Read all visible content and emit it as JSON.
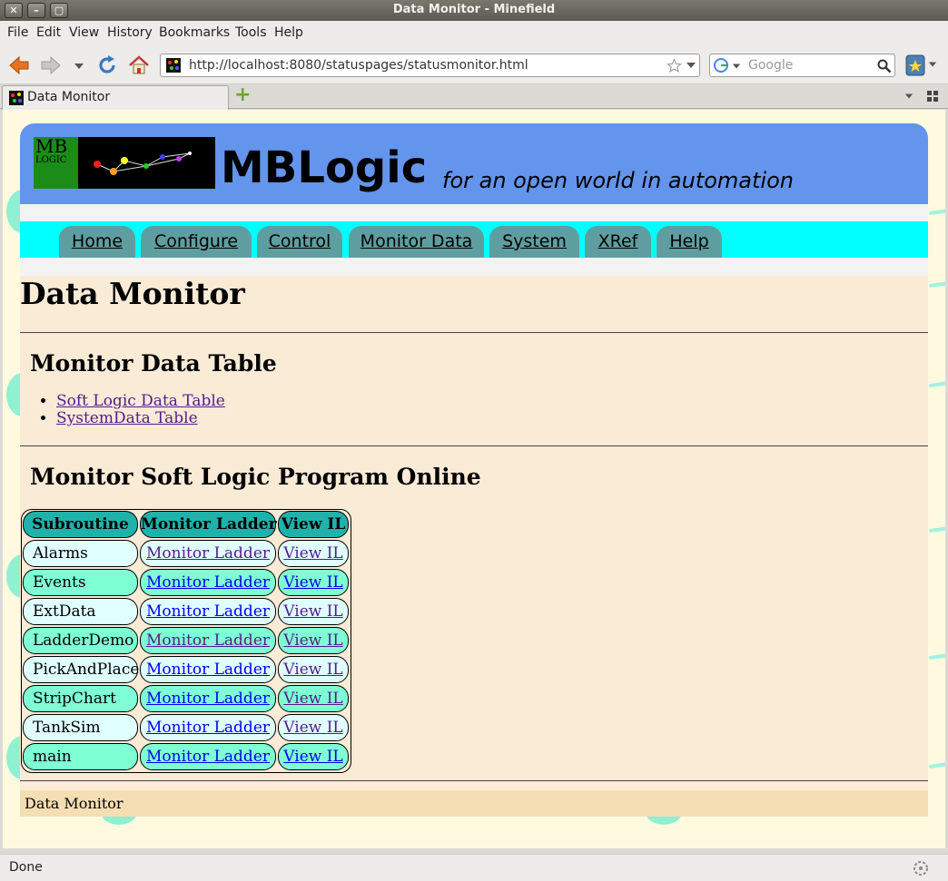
{
  "window": {
    "title": "Data Monitor - Minefield",
    "close_glyph": "✕",
    "minimize_glyph": "–",
    "maximize_glyph": "▢"
  },
  "menubar": {
    "items": [
      "File",
      "Edit",
      "View",
      "History",
      "Bookmarks",
      "Tools",
      "Help"
    ]
  },
  "navbar": {
    "url": "http://localhost:8080/statuspages/statusmonitor.html",
    "search_placeholder": "Google"
  },
  "tab": {
    "label": "Data Monitor",
    "new_tab_glyph": "+"
  },
  "banner": {
    "logo_mb": "MB",
    "logo_logic": "LOGIC",
    "brand": "MBLogic",
    "tagline": "for an open world in automation"
  },
  "menu": {
    "items": [
      "Home",
      "Configure",
      "Control",
      "Monitor Data",
      "System",
      "XRef",
      "Help"
    ]
  },
  "content": {
    "page_title": "Data Monitor",
    "section1_title": "Monitor Data Table",
    "links": [
      "Soft Logic Data Table",
      "SystemData Table"
    ],
    "section2_title": "Monitor Soft Logic Program Online",
    "table": {
      "headers": [
        "Subroutine",
        "Monitor Ladder",
        "View IL"
      ],
      "rows": [
        {
          "name": "Alarms",
          "ladder": "Monitor Ladder",
          "il": "View IL"
        },
        {
          "name": "Events",
          "ladder": "Monitor Ladder",
          "il": "View IL"
        },
        {
          "name": "ExtData",
          "ladder": "Monitor Ladder",
          "il": "View IL"
        },
        {
          "name": "LadderDemo",
          "ladder": "Monitor Ladder",
          "il": "View IL"
        },
        {
          "name": "PickAndPlace",
          "ladder": "Monitor Ladder",
          "il": "View IL"
        },
        {
          "name": "StripChart",
          "ladder": "Monitor Ladder",
          "il": "View IL"
        },
        {
          "name": "TankSim",
          "ladder": "Monitor Ladder",
          "il": "View IL"
        },
        {
          "name": "main",
          "ladder": "Monitor Ladder",
          "il": "View IL"
        }
      ]
    },
    "footer": "Data Monitor"
  },
  "status": {
    "text": "Done"
  },
  "colors": {
    "banner": "#6495ed",
    "menu_strip": "#00ffff",
    "menu_tab": "#5f9ea0",
    "content_bg": "#faebd7",
    "table_head": "#20b2aa",
    "row_light": "#e0ffff",
    "row_mint": "#7fffd4",
    "footer": "#f5deb3",
    "visited_link": "#551a8b",
    "unvisited_link": "#0000ee"
  }
}
